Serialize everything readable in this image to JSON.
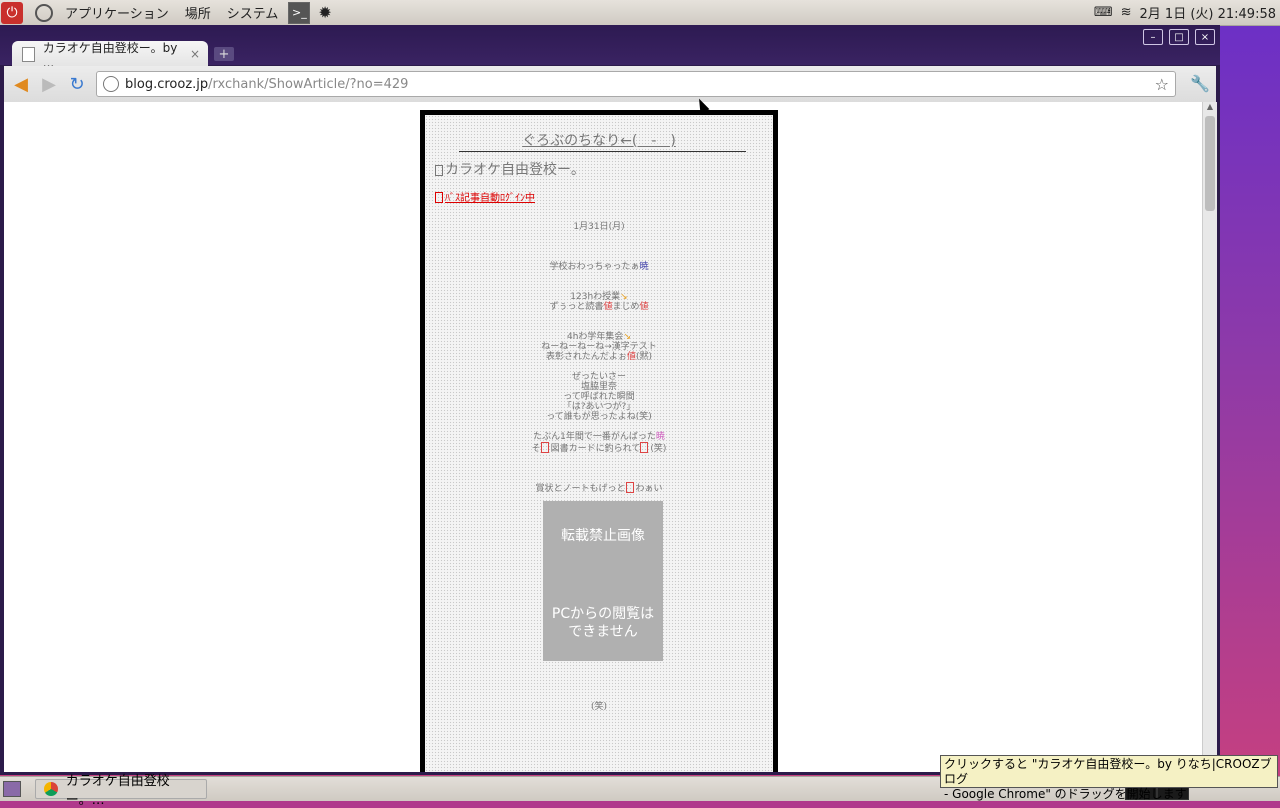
{
  "top_panel": {
    "menus": [
      "アプリケーション",
      "場所",
      "システム"
    ],
    "clock": "2月 1日 (火) 21:49:58"
  },
  "window": {
    "tab_title": "カラオケ自由登校ー。by ...",
    "tab_close": "×",
    "new_tab": "+",
    "controls": {
      "minimize": "–",
      "maximize": "□",
      "close": "×"
    }
  },
  "address": {
    "host": "blog.crooz.jp",
    "path": "/rxchank/ShowArticle/?no=429"
  },
  "blog": {
    "title": "ぐろぶのちなり←(　-　)",
    "article_title": "カラオケ自由登校ー。",
    "login_link": "ﾊﾞｽ記事自動ﾛｸﾞｲﾝ中",
    "date": "1月31日(月)",
    "lines": {
      "l1a": "学校おわっちゃったぁ",
      "l1b": "暁",
      "l2a": "123hわ授業",
      "l2b": "↘",
      "l3a": "ずぅっと読書",
      "l3b": "値",
      "l3c": "まじめ",
      "l3d": "値",
      "l4a": "4hわ学年集会",
      "l4b": "↘",
      "l5": "ねーねーねーね→漢字テスト",
      "l6a": "表彰されたんだよぉ",
      "l6b": "値",
      "l6c": "(黙)",
      "l7": "ぜったいさー",
      "l8": "塩脇里奈",
      "l9": "って呼ばれた瞬間",
      "l10": "「は?あいつが?」",
      "l11": "って誰もが思ったよね(笑)",
      "l12a": "たぶん1年間で一番がんばった",
      "l12b": "暁",
      "l13a": "そ",
      "l13b": "図書カードに釣られて",
      "l13c": "(笑)",
      "l14a": "賞状とノートもげっと",
      "l14b": "わぁい",
      "l15": "(笑)"
    },
    "image_placeholder": {
      "line1": "転載禁止画像",
      "line2": "PCからの閲覧は",
      "line3": "できません"
    }
  },
  "tooltip": {
    "line1": "クリックすると \"カラオケ自由登校ー。by りなち|CROOZブログ",
    "line2": "- Google Chrome\" のドラッグを開始します"
  },
  "taskbar": {
    "window_button": "カラオケ自由登校ー。…"
  }
}
